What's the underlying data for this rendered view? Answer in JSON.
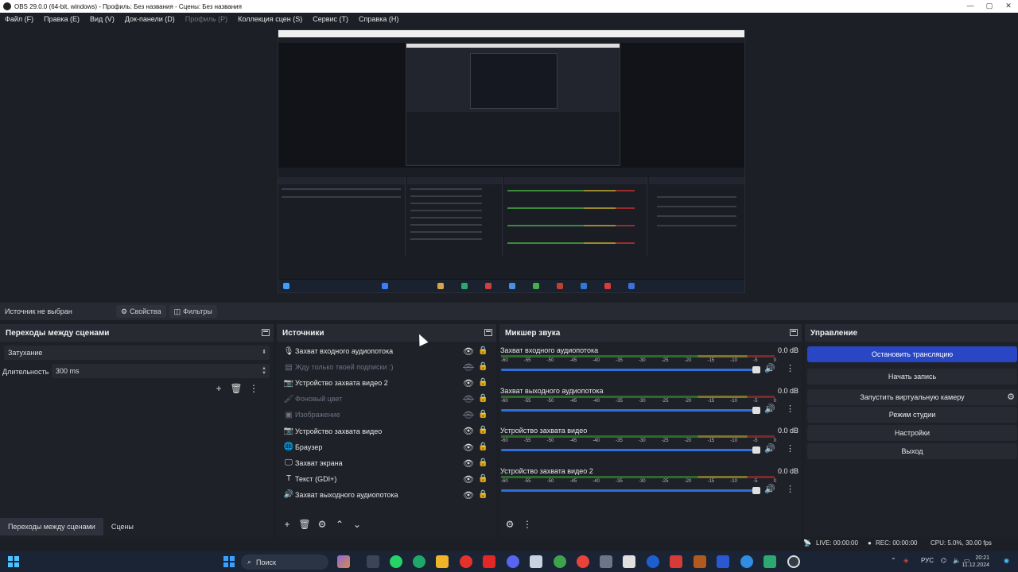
{
  "window": {
    "title": "OBS 29.0.0 (64-bit, windows) - Профиль: Без названия - Сцены: Без названия",
    "controls": [
      "—",
      "▢",
      "✕"
    ]
  },
  "menu": [
    {
      "label": "Файл (F)"
    },
    {
      "label": "Правка (E)"
    },
    {
      "label": "Вид (V)"
    },
    {
      "label": "Док-панели (D)"
    },
    {
      "label": "Профиль (P)",
      "disabled": true
    },
    {
      "label": "Коллекция сцен (S)"
    },
    {
      "label": "Сервис (T)"
    },
    {
      "label": "Справка (H)"
    }
  ],
  "source_bar": {
    "no_source": "Источник не выбран",
    "properties": "Свойства",
    "filters": "Фильтры"
  },
  "transitions": {
    "title": "Переходы между сценами",
    "selected": "Затухание",
    "duration_label": "Длительность",
    "duration_value": "300 ms",
    "add_icon": "+",
    "delete_icon": "🗑",
    "menu_icon": "⋮"
  },
  "sources": {
    "title": "Источники",
    "items": [
      {
        "icon": "mic-icon",
        "glyph": "🎙",
        "label": "Захват входного аудиопотока",
        "visible": true,
        "locked": false
      },
      {
        "icon": "slideshow-icon",
        "glyph": "▤",
        "label": "Жду только твоей подписки :)",
        "visible": false,
        "locked": false
      },
      {
        "icon": "camera-icon",
        "glyph": "📷",
        "label": "Устройство захвата видео 2",
        "visible": true,
        "locked": false
      },
      {
        "icon": "color-icon",
        "glyph": "🖌",
        "label": "Фоновый цвет",
        "visible": false,
        "locked": false
      },
      {
        "icon": "image-icon",
        "glyph": "▣",
        "label": "Изображение",
        "visible": false,
        "locked": false
      },
      {
        "icon": "camera-icon",
        "glyph": "📷",
        "label": "Устройство захвата видео",
        "visible": true,
        "locked": false
      },
      {
        "icon": "browser-icon",
        "glyph": "🌐",
        "label": "Браузер",
        "visible": true,
        "locked": false
      },
      {
        "icon": "monitor-icon",
        "glyph": "🖵",
        "label": "Захват экрана",
        "visible": true,
        "locked": false
      },
      {
        "icon": "text-icon",
        "glyph": "T",
        "label": "Текст (GDI+)",
        "visible": true,
        "locked": true
      },
      {
        "icon": "speaker-icon",
        "glyph": "🔊",
        "label": "Захват выходного аудиопотока",
        "visible": true,
        "locked": false
      }
    ]
  },
  "mixer": {
    "title": "Микшер звука",
    "scale": [
      "-60",
      "-55",
      "-50",
      "-45",
      "-40",
      "-35",
      "-30",
      "-25",
      "-20",
      "-15",
      "-10",
      "-5",
      "0"
    ],
    "channels": [
      {
        "name": "Захват входного аудиопотока",
        "db": "0.0 dB"
      },
      {
        "name": "Захват выходного аудиопотока",
        "db": "0.0 dB"
      },
      {
        "name": "Устройство захвата видео",
        "db": "0.0 dB"
      },
      {
        "name": "Устройство захвата видео 2",
        "db": "0.0 dB"
      }
    ]
  },
  "controls": {
    "title": "Управление",
    "stop_stream": "Остановить трансляцию",
    "start_record": "Начать запись",
    "virtual_cam": "Запустить виртуальную камеру",
    "studio_mode": "Режим студии",
    "settings": "Настройки",
    "exit": "Выход"
  },
  "scene_tabs": {
    "transitions": "Переходы между сценами",
    "scenes": "Сцены"
  },
  "status": {
    "live": "LIVE: 00:00:00",
    "rec": "REC: 00:00:00",
    "cpu": "CPU: 5.0%, 30.00 fps"
  },
  "taskbar": {
    "search": "Поиск",
    "lang": "РУС",
    "time": "20:21",
    "date": "11.12.2024"
  }
}
